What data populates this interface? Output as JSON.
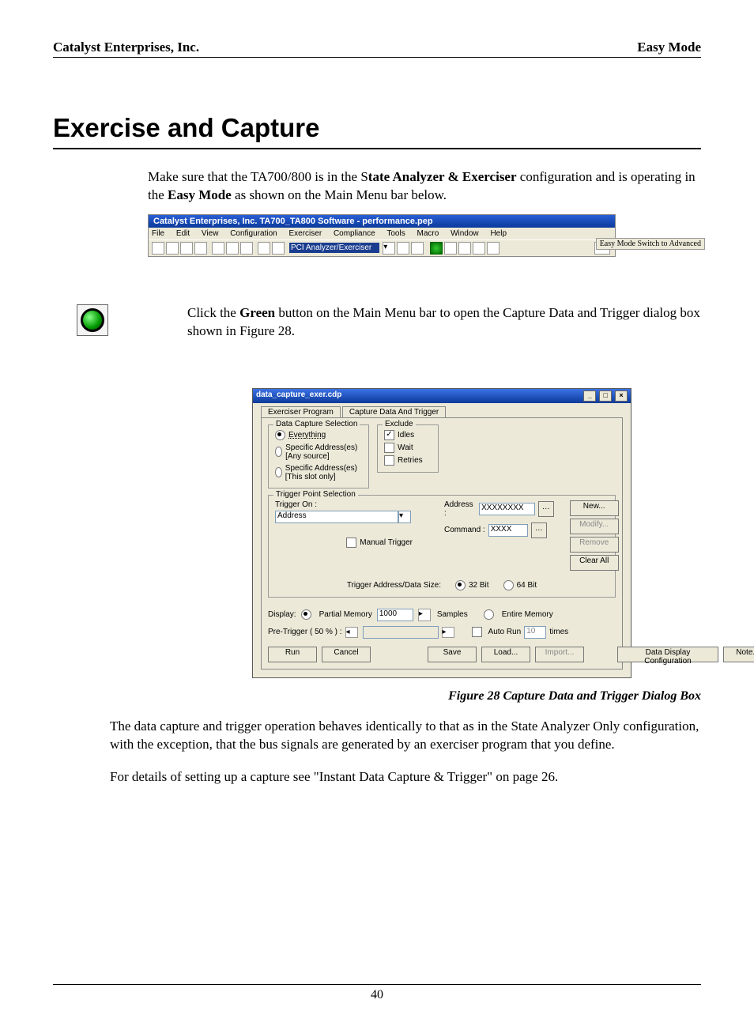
{
  "header": {
    "left": "Catalyst Enterprises, Inc.",
    "right": "Easy Mode"
  },
  "title": "Exercise and Capture",
  "para1_pre": "Make sure that the TA700/800 is in the S",
  "para1_bold1": "tate Analyzer & Exerciser",
  "para1_mid": " configuration and is operating in the ",
  "para1_bold2": "Easy Mode",
  "para1_post": " as shown on the Main Menu bar below.",
  "toolbar": {
    "title": "Catalyst Enterprises, Inc. TA700_TA800 Software - performance.pep",
    "menus": [
      "File",
      "Edit",
      "View",
      "Configuration",
      "Exerciser",
      "Compliance",
      "Tools",
      "Macro",
      "Window",
      "Help"
    ],
    "pci_label": "PCI Analyzer/Exerciser",
    "status": "Easy Mode Switch to Advanced"
  },
  "para2_pre": "Click the ",
  "para2_bold": "Green",
  "para2_post": " button on the Main Menu bar to open the Capture Data and Trigger dialog box shown in Figure 28.",
  "dialog": {
    "title": "data_capture_exer.cdp",
    "tabs": {
      "t1": "Exerciser Program",
      "t2": "Capture Data And Trigger"
    },
    "capture_group": "Data Capture Selection",
    "opt_everything": "Everything",
    "opt_any": "Specific Address(es) [Any source]",
    "opt_slot": "Specific Address(es) [This slot only]",
    "exclude_group": "Exclude",
    "chk_idles": "Idles",
    "chk_wait": "Wait",
    "chk_retries": "Retries",
    "trigger_group": "Trigger Point Selection",
    "trigger_on": "Trigger On :",
    "trigger_dropdown": "Address",
    "addr_lbl": "Address :",
    "addr_val": "XXXXXXXX",
    "cmd_lbl": "Command :",
    "cmd_val": "XXXX",
    "manual": "Manual Trigger",
    "tads": "Trigger Address/Data Size:",
    "r32": "32 Bit",
    "r64": "64 Bit",
    "side": {
      "new": "New...",
      "modify": "Modify...",
      "remove": "Remove",
      "clearall": "Clear All"
    },
    "display_lbl": "Display:",
    "partial": "Partial Memory",
    "partial_val": "1000",
    "samples": "Samples",
    "entire": "Entire Memory",
    "pretrig_lbl": "Pre-Trigger ( 50 % ) :",
    "autorun": "Auto Run",
    "autorun_val": "10",
    "times": "times",
    "btns": {
      "run": "Run",
      "cancel": "Cancel",
      "save": "Save",
      "load": "Load...",
      "import": "Import...",
      "ddc": "Data Display Configuration",
      "note": "Note..."
    }
  },
  "figcaption": "Figure  28  Capture Data and Trigger Dialog Box",
  "para3": "The data capture and trigger operation behaves identically to that as in the State Analyzer Only configuration, with the exception, that the bus signals are generated by an exerciser program that you define.",
  "para4": "For details of setting up a capture see  \"Instant Data Capture & Trigger\" on page 26.",
  "pagenum": "40"
}
